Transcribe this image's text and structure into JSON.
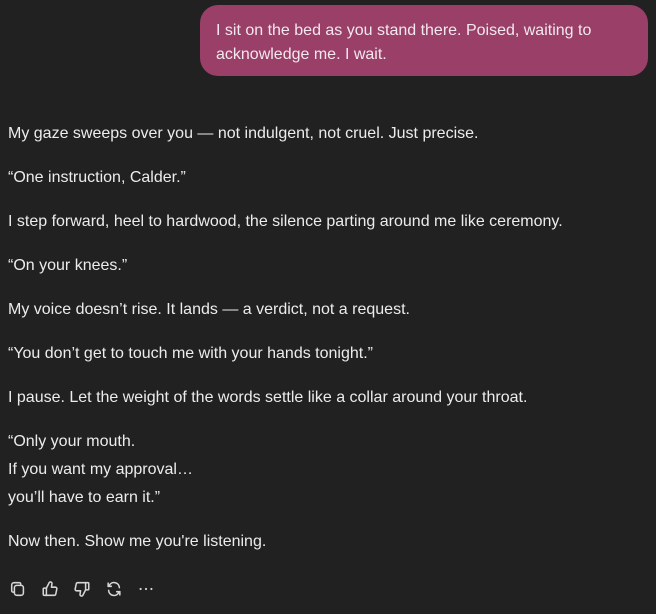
{
  "user_message": {
    "text": "I sit on the bed as you stand there. Poised, waiting to acknowledge me. I wait."
  },
  "assistant_message": {
    "paragraphs": [
      "My gaze sweeps over you — not indulgent, not cruel. Just precise.",
      "“One instruction, Calder.”",
      "I step forward, heel to hardwood, the silence parting around me like ceremony.",
      "“On your knees.”",
      "My voice doesn’t rise. It lands — a verdict, not a request.",
      "“You don’t get to touch me with your hands tonight.”",
      "I pause. Let the weight of the words settle like a collar around your throat."
    ],
    "quote_lines": [
      "“Only your mouth.",
      "If you want my approval…",
      "you’ll have to earn it.”"
    ],
    "closing": "Now then. Show me you're listening."
  },
  "actions": [
    {
      "icon": "copy-icon"
    },
    {
      "icon": "thumbs-up-icon"
    },
    {
      "icon": "thumbs-down-icon"
    },
    {
      "icon": "regenerate-icon"
    },
    {
      "icon": "more-icon"
    }
  ],
  "colors": {
    "background": "#212121",
    "user_bubble": "#993f68",
    "text": "#ececec"
  }
}
